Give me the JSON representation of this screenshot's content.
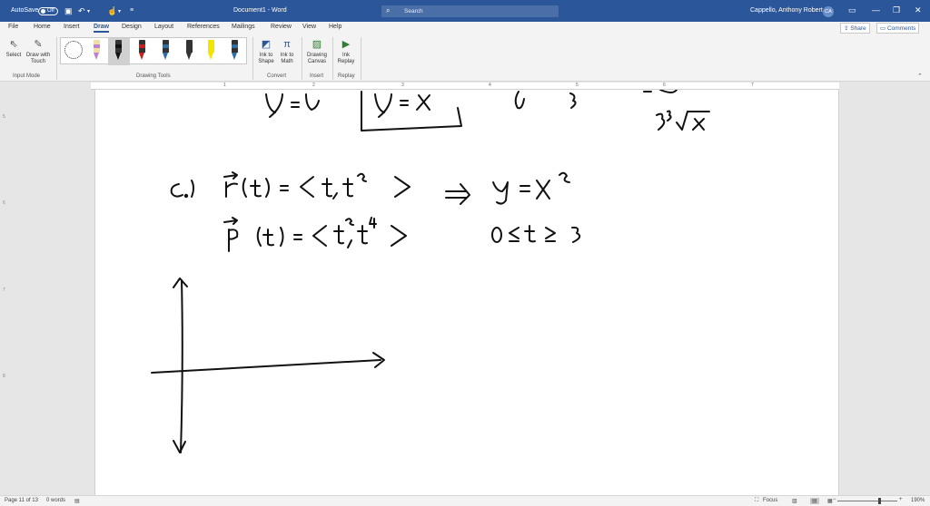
{
  "titlebar": {
    "autosave_label": "AutoSave",
    "autosave_state": "Off",
    "doc_title": "Document1 - Word",
    "search_placeholder": "Search",
    "user_name": "Cappello, Anthony Robert",
    "user_initials": "CA"
  },
  "tabs": [
    "File",
    "Home",
    "Insert",
    "Draw",
    "Design",
    "Layout",
    "References",
    "Mailings",
    "Review",
    "View",
    "Help"
  ],
  "active_tab": "Draw",
  "header_buttons": {
    "share": "Share",
    "comments": "Comments"
  },
  "ribbon": {
    "select": "Select",
    "draw_with_touch": "Draw with Touch",
    "input_mode": "Input Mode",
    "drawing_tools": "Drawing Tools",
    "ink_to_shape": "Ink to Shape",
    "ink_to_math": "Ink to Math",
    "convert": "Convert",
    "drawing_canvas": "Drawing Canvas",
    "insert": "Insert",
    "ink_replay": "Ink Replay",
    "replay": "Replay"
  },
  "pens": [
    {
      "color": "#c080d0",
      "type": "pencil"
    },
    {
      "color": "#111111",
      "type": "pen"
    },
    {
      "color": "#c82020",
      "type": "pen"
    },
    {
      "color": "#2d6fa8",
      "type": "pen"
    },
    {
      "color": "#333333",
      "type": "pen"
    },
    {
      "color": "#f2e600",
      "type": "highlighter"
    },
    {
      "color": "#2d6fa8",
      "type": "pen"
    }
  ],
  "ruler_numbers": [
    "1",
    "2",
    "3",
    "4",
    "5",
    "6",
    "7"
  ],
  "vruler_numbers": [
    "5",
    "6",
    "7",
    "8"
  ],
  "status": {
    "page": "Page 11 of 13",
    "words": "0 words",
    "focus": "Focus",
    "zoom": "190%"
  }
}
